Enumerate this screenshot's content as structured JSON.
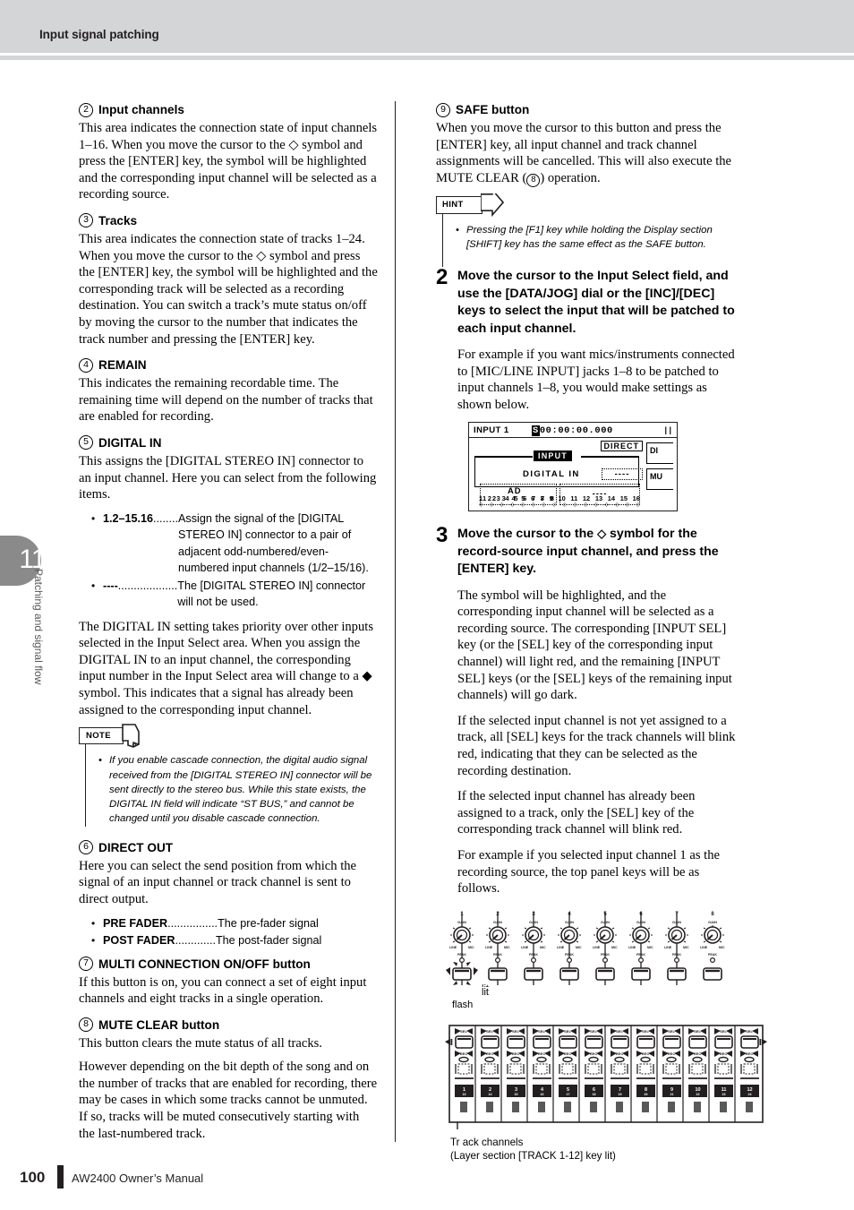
{
  "header": {
    "title": "Input signal patching"
  },
  "chapter_tab": {
    "number": "11",
    "label": "Patching and signal flow"
  },
  "footer": {
    "page_number": "100",
    "manual": "AW2400  Owner’s Manual"
  },
  "left_column": {
    "sections": [
      {
        "num": "2",
        "heading": "Input channels",
        "paragraphs": [
          "This area indicates the connection state of input channels 1–16. When you move the cursor to the ◇ symbol and press the [ENTER] key, the symbol will be highlighted and the corresponding input channel will be selected as a recording source."
        ]
      },
      {
        "num": "3",
        "heading": "Tracks",
        "paragraphs": [
          "This area indicates the connection state of tracks 1–24. When you move the cursor to the ◇ symbol and press the [ENTER] key, the symbol will be highlighted and the corresponding track will be selected as a recording destination. You can switch a track’s mute status on/off by moving the cursor to the number that indicates the track number and pressing the [ENTER] key."
        ]
      },
      {
        "num": "4",
        "heading": "REMAIN",
        "paragraphs": [
          "This indicates the remaining recordable time. The remaining time will depend on the number of tracks that are enabled for recording."
        ]
      },
      {
        "num": "5",
        "heading": "DIGITAL IN",
        "paragraphs": [
          "This assigns the [DIGITAL STEREO IN] connector to an input channel. Here you can select from the following items."
        ]
      }
    ],
    "digital_in_items": [
      {
        "term": "1.2–15.16",
        "dots": "........",
        "desc": "Assign the signal of the [DIGITAL STEREO IN] connector to a pair of adjacent odd-numbered/even-numbered input channels (1/2–15/16)."
      },
      {
        "term": "----",
        "dots": "...................",
        "desc": "The [DIGITAL STEREO IN] connector will not be used."
      }
    ],
    "digital_in_paragraph": "The DIGITAL IN setting takes priority over other inputs selected in the Input Select area. When you assign the DIGITAL IN to an input channel, the corresponding input number in the Input Select area will change to a ◆ symbol. This indicates that a signal has already been assigned to the corresponding input channel.",
    "note": {
      "label": "NOTE",
      "text": "If you enable cascade connection, the digital audio signal received from the [DIGITAL STEREO IN] connector will be sent directly to the stereo bus. While this state exists, the DIGITAL IN field will indicate “ST BUS,” and cannot be changed until you disable cascade connection."
    },
    "direct_out": {
      "num": "6",
      "heading": "DIRECT OUT",
      "paragraph": "Here you can select the send position from which the signal of an input channel or track channel is sent to direct output.",
      "items": [
        {
          "term": "PRE FADER",
          "dots": "................",
          "desc": "The pre-fader signal"
        },
        {
          "term": "POST FADER",
          "dots": ".............",
          "desc": "The post-fader signal"
        }
      ]
    },
    "multi_connection": {
      "num": "7",
      "heading": "MULTI CONNECTION ON/OFF button",
      "paragraph": "If this button is on, you can connect a set of eight input channels and eight tracks in a single operation."
    },
    "mute_clear": {
      "num": "8",
      "heading": "MUTE CLEAR button",
      "paragraphs": [
        "This button clears the mute status of all tracks.",
        "However depending on the bit depth of the song and on the number of tracks that are enabled for recording, there may be cases in which some tracks cannot be unmuted. If so, tracks will be muted consecutively starting with the last-numbered track."
      ]
    }
  },
  "right_column": {
    "safe": {
      "num": "9",
      "heading": "SAFE button",
      "paragraph_a": "When you move the cursor to this button and press the [ENTER] key, all input channel and track channel assignments will be cancelled. This will also execute the MUTE CLEAR (",
      "paragraph_b": ") operation.",
      "mute_clear_ref": "8"
    },
    "hint": {
      "label": "HINT",
      "text": "Pressing the [F1] key while holding the Display section [SHIFT] key has the same effect as the SAFE button."
    },
    "step2": {
      "num": "2",
      "bold": "Move the cursor to the Input Select field, and use the [DATA/JOG] dial or the [INC]/[DEC] keys to select the input that will be patched to each input channel.",
      "body": "For example if you want mics/instruments connected to [MIC/LINE INPUT] jacks 1–8 to be patched to input channels 1–8, you would make settings as shown below."
    },
    "lcd": {
      "title": "INPUT 1",
      "time": "00:00:00.000",
      "time_flag": "S",
      "direct_label": "DIRECT",
      "input_tag": "INPUT",
      "digital_in_label": "DIGITAL IN",
      "digital_in_value": "----",
      "ad_label": "AD",
      "ad_numbers": [
        "1",
        "2",
        "3",
        "4",
        "5",
        "6",
        "7",
        "8"
      ],
      "empty_value": "----",
      "channel_numbers": [
        "1",
        "2",
        "3",
        "4",
        "5",
        "6",
        "7",
        "8",
        "9",
        "10",
        "11",
        "12",
        "13",
        "14",
        "15",
        "16"
      ],
      "right_buttons": [
        "DI",
        "MU"
      ]
    },
    "step3": {
      "num": "3",
      "bold_a": "Move the cursor to the ",
      "bold_diamond": "◇",
      "bold_b": " symbol for the record-source input channel, and press the [ENTER] key.",
      "paragraphs": [
        "The symbol will be highlighted, and the corresponding input channel will be selected as a recording source. The corresponding [INPUT SEL] key (or the [SEL] key of the corresponding input channel) will light red, and the remaining [INPUT SEL] keys (or the [SEL] keys of the remaining input channels) will go dark.",
        "If the selected input channel is not yet assigned to a track, all [SEL] keys for the track channels will blink red, indicating that they can be selected as the recording destination.",
        "If the selected input channel has already been assigned to a track, only the [SEL] key of the corresponding track channel will blink red.",
        "For example if you selected input channel 1 as the recording source, the top panel keys will be as follows."
      ]
    },
    "input_panel": {
      "channel_numbers": [
        "1",
        "2",
        "3",
        "4",
        "5",
        "6",
        "7",
        "8"
      ],
      "gain_label": "GAIN",
      "line_label": "LINE",
      "mic_label": "MIC",
      "peak_label": "PEAK",
      "lit_caption": "lit",
      "flash_caption": "flash"
    },
    "track_panel": {
      "sel_label": "SEL",
      "rec_label": "REC",
      "channels": [
        {
          "top": "1",
          "bottom": "13"
        },
        {
          "top": "2",
          "bottom": "14"
        },
        {
          "top": "3",
          "bottom": "15"
        },
        {
          "top": "4",
          "bottom": "16"
        },
        {
          "top": "5",
          "bottom": "17"
        },
        {
          "top": "6",
          "bottom": "18"
        },
        {
          "top": "7",
          "bottom": "19"
        },
        {
          "top": "8",
          "bottom": "20"
        },
        {
          "top": "9",
          "bottom": "21"
        },
        {
          "top": "10",
          "bottom": "22"
        },
        {
          "top": "11",
          "bottom": "23"
        },
        {
          "top": "12",
          "bottom": "24"
        }
      ],
      "caption_line1": "Tr ack channels",
      "caption_line2": "(Layer section [TRACK 1-12] key lit)"
    }
  }
}
